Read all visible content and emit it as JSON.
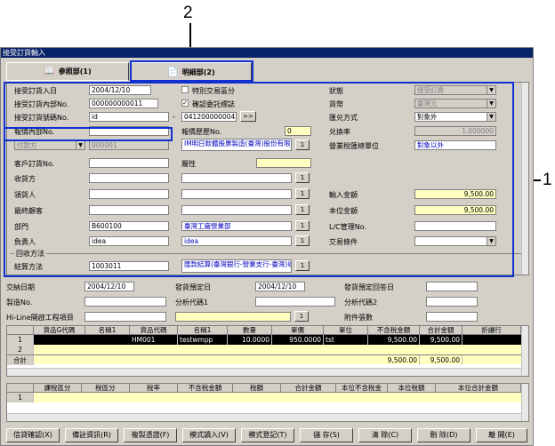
{
  "callouts": {
    "two": "2",
    "one": "1"
  },
  "window": {
    "title": "接受訂貨輸入"
  },
  "tabs": [
    {
      "label": "参照部(1)"
    },
    {
      "label": "明細部(2)"
    }
  ],
  "form": {
    "order_date": {
      "label": "接受訂貨入日",
      "value": "2004/12/10"
    },
    "special_trade": {
      "label": "特別交易區分"
    },
    "status": {
      "label": "狀態",
      "value": "接受訂貨"
    },
    "internal_no": {
      "label": "接受訂貨內部No.",
      "value": "000000000011"
    },
    "confirm_flag": {
      "label": "確認委託標誌",
      "checked": "✓"
    },
    "currency": {
      "label": "貨幣",
      "value": "臺灣元"
    },
    "order_no": {
      "label": "接受訂貨號碼No.",
      "value": "id",
      "value2": "041200000004",
      "btn": ">>"
    },
    "fx_method": {
      "label": "匯兑方式",
      "value": "對象外"
    },
    "quote_no": {
      "label": "報價內部No."
    },
    "quote_hist": {
      "label": "報價歷歷No.",
      "value": "0"
    },
    "fx_rate": {
      "label": "兑換率",
      "value": "1.000000"
    },
    "pay_method": {
      "label": "付款方",
      "value": "000001",
      "extra": "付款方"
    },
    "pay_name": {
      "value": "IM明日軟體股票製造(臺灣)股份有限公司"
    },
    "tax_unit": {
      "label": "營業稅匯總單位",
      "value": "對象以外"
    },
    "client_no": {
      "label": "客戶訂貨No.",
      "attr_label": "屬性"
    },
    "receiver": {
      "label": "收貨方"
    },
    "consignee": {
      "label": "領貨人"
    },
    "input_amount": {
      "label": "輸入金額",
      "value": "9,500.00"
    },
    "final_customer": {
      "label": "最終顧客"
    },
    "base_amount": {
      "label": "本位金額",
      "value": "9,500.00"
    },
    "department": {
      "label": "部門",
      "code": "B600100",
      "name": "臺灣工廠營業部"
    },
    "lc_no": {
      "label": "L/C管理No."
    },
    "owner": {
      "label": "負責人",
      "code": "idea",
      "name": "idea"
    },
    "trade_terms": {
      "label": "交易條件"
    },
    "collection": {
      "legend": "回收方法",
      "label": "結算方法",
      "code": "1003011",
      "name": "匯款結算(臺灣銀行-營業支行-臺灣)收入目1"
    }
  },
  "lower": {
    "delivery_date": {
      "label": "交納日期",
      "value": "2004/12/10"
    },
    "ship_plan": {
      "label": "發貨預定日",
      "value": "2004/12/10"
    },
    "ship_reply": {
      "label": "發貨預定回答日"
    },
    "mfg_no": {
      "label": "製造No.",
      "analysis1": "分析代碼1",
      "analysis2": "分析代碼2"
    },
    "hiline": {
      "label": "Hi-Line開啟工程項目",
      "attach": "附件張數"
    }
  },
  "items_grid": {
    "headers": [
      "貨品G代碼",
      "名稱1",
      "貨品代碼",
      "名稱1",
      "數量",
      "單價",
      "單位",
      "不含稅金額",
      "合計金額",
      "折讓行"
    ],
    "rows": [
      {
        "no": "1",
        "cells": [
          "",
          "",
          "HM001",
          "testwmpp",
          "10.0000",
          "950.0000",
          "tst",
          "9,500.00",
          "9,500.00",
          ""
        ]
      },
      {
        "no": "2",
        "cells": [
          "",
          "",
          "",
          "",
          "",
          "",
          "",
          "",
          "",
          ""
        ]
      }
    ],
    "total_label": "合計",
    "totals": [
      "9,500.00",
      "9,500.00"
    ]
  },
  "tax_grid": {
    "headers": [
      "課稅區分",
      "稅區分",
      "稅率",
      "不含稅金額",
      "稅額",
      "合計金額",
      "本位不含稅金",
      "本位稅額",
      "本位合計金額"
    ],
    "rows": [
      {
        "no": "1"
      }
    ]
  },
  "buttons": [
    "信貸確認(X)",
    "備註資訊(R)",
    "複製憑證(F)",
    "模式讀入(V)",
    "模式登記(T)",
    "儲 存(S)",
    "清 除(C)",
    "刪 除(D)",
    "離 開(E)"
  ]
}
